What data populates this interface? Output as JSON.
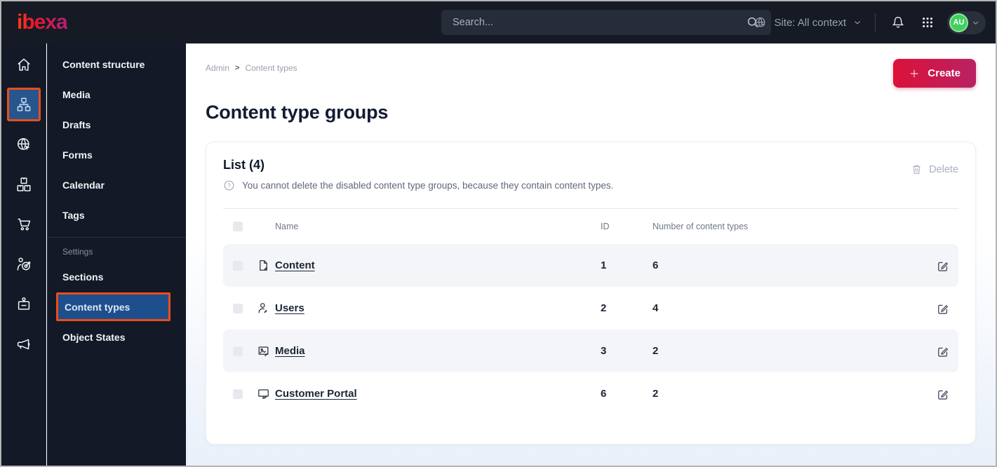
{
  "topbar": {
    "logo": "ibexa",
    "search": {
      "placeholder": "Search..."
    },
    "site_selector": {
      "label": "Site: All context"
    },
    "avatar": {
      "initials": "AU"
    }
  },
  "nav_rail": {
    "items": [
      {
        "icon": "home",
        "active": false
      },
      {
        "icon": "sitemap",
        "active": true
      },
      {
        "icon": "globe-cursor",
        "active": false
      },
      {
        "icon": "packages",
        "active": false
      },
      {
        "icon": "cart",
        "active": false
      },
      {
        "icon": "audience-target",
        "active": false
      },
      {
        "icon": "badge",
        "active": false
      },
      {
        "icon": "megaphone",
        "active": false
      }
    ]
  },
  "sidebar": {
    "items": [
      "Content structure",
      "Media",
      "Drafts",
      "Forms",
      "Calendar",
      "Tags"
    ],
    "settings_label": "Settings",
    "settings_items": [
      "Sections",
      "Content types",
      "Object States"
    ],
    "active_item": "Content types"
  },
  "main": {
    "breadcrumb": {
      "items": [
        "Admin",
        "Content types"
      ],
      "separator": ">"
    },
    "create_button": "Create",
    "page_title": "Content type groups",
    "list": {
      "title": "List (4)",
      "info": "You cannot delete the disabled content type groups, because they contain content types.",
      "delete_button": "Delete",
      "columns": {
        "name": "Name",
        "id": "ID",
        "count": "Number of content types"
      },
      "rows": [
        {
          "icon": "content-file",
          "name": "Content",
          "id": "1",
          "count": "6"
        },
        {
          "icon": "user",
          "name": "Users",
          "id": "2",
          "count": "4"
        },
        {
          "icon": "image",
          "name": "Media",
          "id": "3",
          "count": "2"
        },
        {
          "icon": "monitor",
          "name": "Customer Portal",
          "id": "6",
          "count": "2"
        }
      ]
    }
  },
  "colors": {
    "topbar_bg": "#151a24",
    "sidebar_bg": "#131926",
    "active_blue": "#1d4f8d",
    "highlight_orange": "#e94e1b",
    "create_gradient_start": "#dc1139",
    "create_gradient_end": "#b92263",
    "avatar_green": "#41cf5e",
    "row_alt_bg": "#f4f5f8"
  }
}
